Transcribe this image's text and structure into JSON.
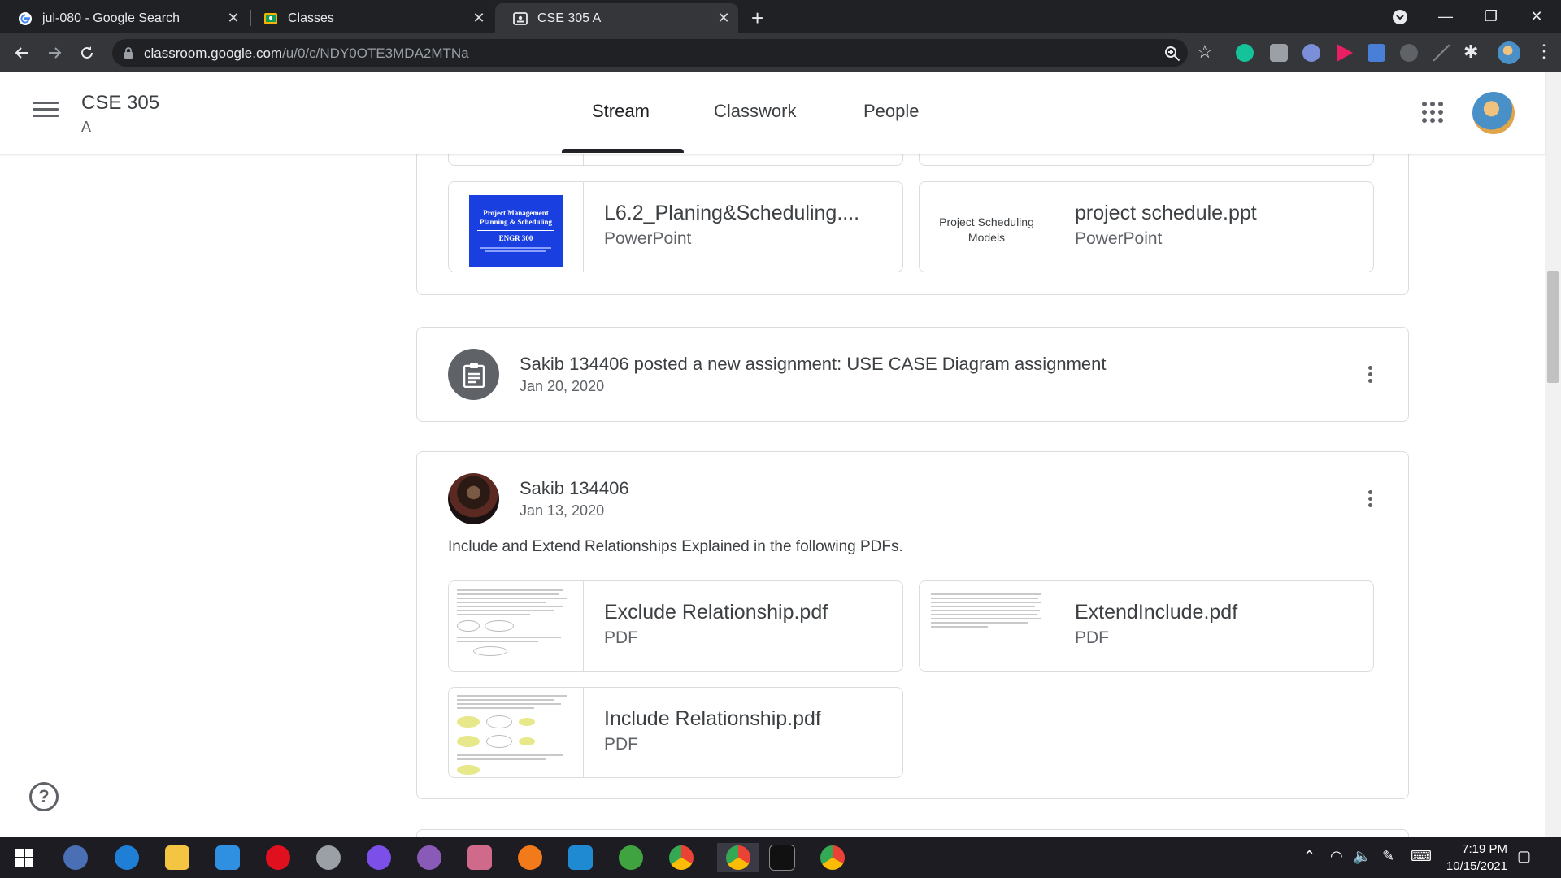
{
  "browser": {
    "tabs": [
      {
        "title": "jul-080 - Google Search",
        "icon": "google-icon"
      },
      {
        "title": "Classes",
        "icon": "classroom-icon"
      },
      {
        "title": "CSE 305 A",
        "icon": "classroom-icon",
        "active": true
      }
    ],
    "url_host": "classroom.google.com",
    "url_path": "/u/0/c/NDY0OTE3MDA2MTNa"
  },
  "header": {
    "class_name": "CSE 305",
    "section": "A",
    "tabs": [
      "Stream",
      "Classwork",
      "People"
    ],
    "active_tab": "Stream"
  },
  "stream": {
    "top_card": {
      "attachments": [
        {
          "name": "L6.2_Planing&Scheduling....",
          "type": "PowerPoint",
          "thumb_lines": [
            "Project Management",
            "Planning & Scheduling",
            "ENGR 300"
          ]
        },
        {
          "name": "project schedule.ppt",
          "type": "PowerPoint",
          "thumb_lines": [
            "Project Scheduling",
            "Models"
          ]
        }
      ]
    },
    "assignment_post": {
      "text": "Sakib 134406 posted a new assignment: USE CASE Diagram assignment",
      "date": "Jan 20, 2020"
    },
    "post": {
      "author": "Sakib 134406",
      "date": "Jan 13, 2020",
      "body": "Include and Extend Relationships Explained in the following PDFs.",
      "attachments": [
        {
          "name": "Exclude Relationship.pdf",
          "type": "PDF"
        },
        {
          "name": "ExtendInclude.pdf",
          "type": "PDF"
        },
        {
          "name": "Include Relationship.pdf",
          "type": "PDF"
        }
      ]
    }
  },
  "taskbar": {
    "time": "7:19 PM",
    "date": "10/15/2021"
  },
  "colors": {
    "browser_dark": "#202124",
    "toolbar": "#35363a",
    "assignment_icon_bg": "#5f6368",
    "ppt_thumb_blue": "#1a3fe0"
  }
}
